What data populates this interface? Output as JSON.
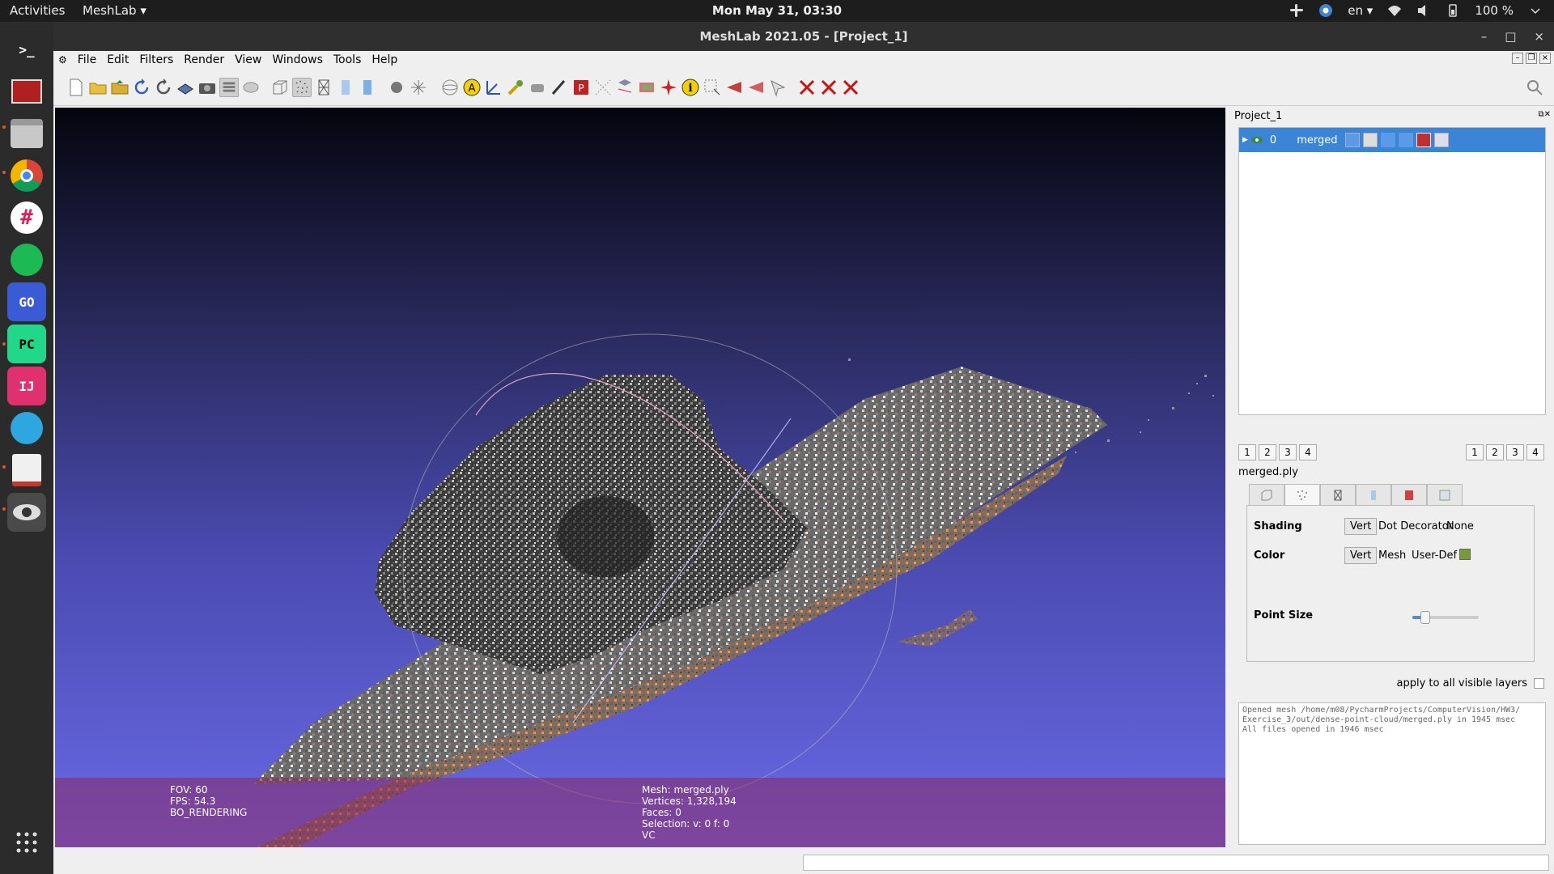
{
  "topbar": {
    "activities": "Activities",
    "app_menu": "MeshLab ▾",
    "clock": "Mon May 31, 03:30",
    "language": "en ▾",
    "battery": "100 %"
  },
  "dock": {
    "items": [
      {
        "name": "terminal",
        "label": ">_",
        "color": "#2d2d2d"
      },
      {
        "name": "meshlab-dock",
        "label": "",
        "color": "#b02020"
      },
      {
        "name": "files",
        "label": "",
        "color": "#c8c8c8"
      },
      {
        "name": "chrome",
        "label": "",
        "color": "#2b2b2b"
      },
      {
        "name": "slack",
        "label": "",
        "color": "#ffffff"
      },
      {
        "name": "spotify",
        "label": "",
        "color": "#1db954"
      },
      {
        "name": "goland",
        "label": "GO",
        "color": "#3b5bd6"
      },
      {
        "name": "pycharm",
        "label": "PC",
        "color": "#21d789"
      },
      {
        "name": "intellij",
        "label": "IJ",
        "color": "#e0306d"
      },
      {
        "name": "telegram",
        "label": "",
        "color": "#2ea6df"
      },
      {
        "name": "pdf-viewer",
        "label": "",
        "color": "#f0f0f0"
      },
      {
        "name": "meshlab-active",
        "label": "",
        "color": "#4a4a4a"
      }
    ]
  },
  "window": {
    "title": "MeshLab 2021.05 - [Project_1]",
    "menu": [
      "File",
      "Edit",
      "Filters",
      "Render",
      "View",
      "Windows",
      "Tools",
      "Help"
    ]
  },
  "viewport": {
    "fov": "FOV: 60",
    "fps": "FPS:   54.3",
    "mode": "BO_RENDERING",
    "mesh": "Mesh: merged.ply",
    "vertices": "Vertices: 1,328,194",
    "faces": "Faces: 0",
    "selection": "Selection: v: 0 f: 0",
    "vc": "VC"
  },
  "panel": {
    "title": "Project_1",
    "layer": {
      "index": "0",
      "name": "merged"
    },
    "num_buttons_left": [
      "1",
      "2",
      "3",
      "4"
    ],
    "num_buttons_right": [
      "1",
      "2",
      "3",
      "4"
    ],
    "file_name": "merged.ply",
    "shading_label": "Shading",
    "shading_options": [
      "Vert",
      "Dot Decorator",
      "None"
    ],
    "color_label": "Color",
    "color_options": [
      "Vert",
      "Mesh",
      "User-Def"
    ],
    "user_def_color": "#7a9a3a",
    "point_size_label": "Point Size",
    "apply_label": "apply to all visible layers",
    "log": "Opened mesh /home/m08/PycharmProjects/ComputerVision/HW3/\nExercise_3/out/dense-point-cloud/merged.ply in 1945 msec\nAll files opened in 1946 msec"
  }
}
